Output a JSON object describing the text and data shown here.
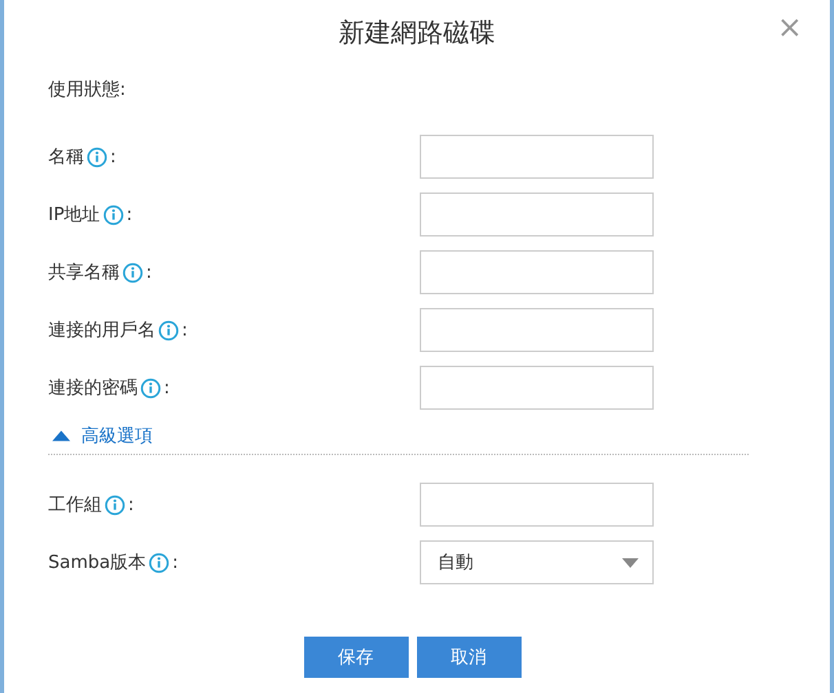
{
  "dialog": {
    "title": "新建網路磁碟",
    "close": "×"
  },
  "status": {
    "label": "使用狀態:"
  },
  "fields": [
    {
      "kind": "text",
      "label": "名稱",
      "suffix": ":"
    },
    {
      "kind": "text",
      "label": "IP地址",
      "suffix": ":"
    },
    {
      "kind": "text",
      "label": "共享名稱",
      "suffix": ":"
    },
    {
      "kind": "text",
      "label": "連接的用戶名",
      "suffix": ":"
    },
    {
      "kind": "text",
      "label": "連接的密碼",
      "suffix": ":"
    }
  ],
  "advanced": {
    "label": "高級選項",
    "expanded": true
  },
  "advanced_fields": [
    {
      "kind": "text",
      "label": "工作組",
      "suffix": ":"
    },
    {
      "kind": "select",
      "label": "Samba版本",
      "suffix": ":",
      "value": "自動"
    }
  ],
  "buttons": [
    {
      "label": "保存"
    },
    {
      "label": "取消"
    }
  ]
}
